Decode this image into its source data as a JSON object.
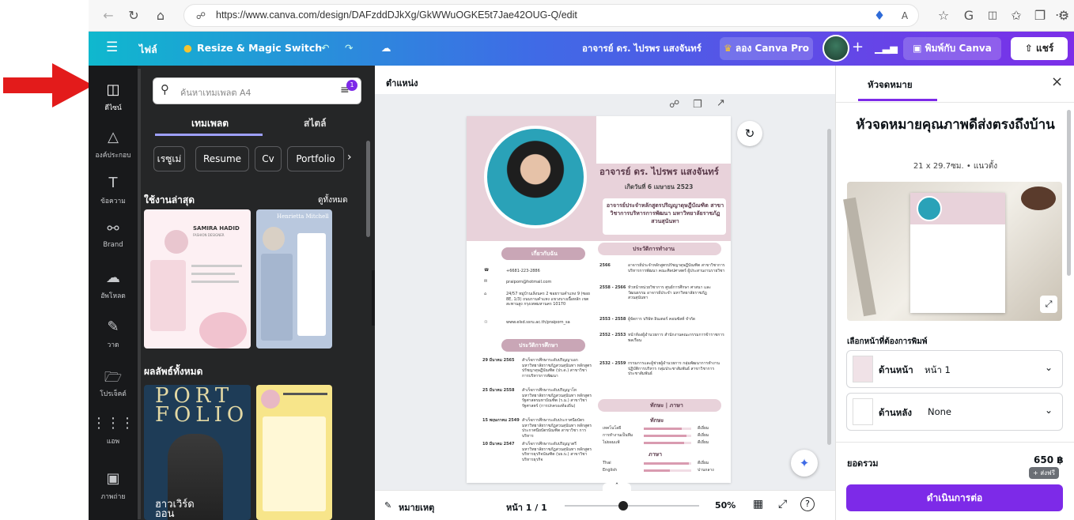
{
  "browser": {
    "url": "https://www.canva.com/design/DAFzddDJkXg/GkWWuOGKE5t7Jae42OUG-Q/edit",
    "icons": [
      "back-icon",
      "refresh-icon",
      "home-icon",
      "lock-icon",
      "favorite-icon",
      "read-aloud-icon",
      "star-icon",
      "copilot-icon",
      "split-icon",
      "favorites-icon",
      "collections-icon",
      "extensions-icon",
      "more-icon"
    ]
  },
  "topbar": {
    "file": "ไฟล์",
    "resize": "Resize & Magic Switch",
    "owner": "อาจารย์ ดร. ไปรพร แสงจันทร์",
    "try_pro": "ลอง Canva Pro",
    "print": "พิมพ์กับ Canva",
    "share": "แชร์"
  },
  "rail": {
    "items": [
      {
        "label": "ดีไซน์",
        "icon": "template-icon"
      },
      {
        "label": "องค์ประกอบ",
        "icon": "elements-icon"
      },
      {
        "label": "ข้อความ",
        "icon": "text-icon"
      },
      {
        "label": "Brand",
        "icon": "brand-icon"
      },
      {
        "label": "อัพโหลด",
        "icon": "upload-icon"
      },
      {
        "label": "วาด",
        "icon": "draw-icon"
      },
      {
        "label": "โปรเจ็คต์",
        "icon": "folder-icon"
      },
      {
        "label": "แอพ",
        "icon": "apps-icon"
      },
      {
        "label": "ภาพถ่าย",
        "icon": "photos-icon"
      }
    ]
  },
  "panel": {
    "search_placeholder": "ค้นหาเทมเพลต A4",
    "badge": "1",
    "tab_templates": "เทมเพลต",
    "tab_styles": "สไตล์",
    "chips": [
      "เรซูเม่",
      "Resume",
      "Cv",
      "Portfolio"
    ],
    "recent_title": "ใช้งานล่าสุด",
    "see_all": "ดูทั้งหมด",
    "all_results": "ผลลัพธ์ทั้งหมด",
    "thumb1_name": "SAMIRA HADID",
    "thumb1_sub": "FASHION DESIGNER",
    "thumb2_name": "Henrietta Mitchell",
    "thumb3_title": "PORT FOLIO",
    "thumb3_name": "ฮาวเวิร์ด ออน"
  },
  "canvas": {
    "position_label": "ตำแหน่ง",
    "notes": "หมายเหตุ",
    "page_indicator": "หน้า 1 / 1",
    "zoom": "50%",
    "zoom_level": 0.5,
    "resume": {
      "name": "อาจารย์ ดร. ไปรพร แสงจันทร์",
      "born": "เกิดวันที่ 6 เมษายน 2523",
      "position": "อาจารย์ประจำหลักสูตรปริญญาดุษฎีบัณฑิต สาขาวิชาการบริหารการพัฒนา มหาวิทยาลัยราชภัฏสวนสุนันทา",
      "about_title": "เกี่ยวกับฉัน",
      "phone": "+6681-223-2886",
      "email": "praiporn@hotmail.com",
      "address": "24/57 หมู่บ้านเลิ่งนคร 2 ซอยรามคำแหง 9 (ซอย 8E, 1/3) ถนนรามคำแหง แขวงบางเนื้อหลัก เขตสะพานสูง กรุงเทพมหานคร 10170",
      "web": "www.elsd.ssru.ac.th/praiporn_sa",
      "edu_title": "ประวัติการศึกษา",
      "edu": [
        {
          "date": "29 มีนาคม 2565",
          "text": "สำเร็จการศึกษาระดับปริญญาเอก มหาวิทยาลัยราชภัฏสวนสุนันทา หลักสูตร ปรัชญาดุษฎีบัณฑิต (ปร.ด.) สาขาวิชา การบริหารการพัฒนา"
        },
        {
          "date": "25 มีนาคม 2558",
          "text": "สำเร็จการศึกษาระดับปริญญาโท มหาวิทยาลัยราชภัฏสวนสุนันทา หลักสูตร รัฐศาสตรมหาบัณฑิต (ร.ม.) สาขาวิชา รัฐศาสตร์ (การปกครองท้องถิ่น)"
        },
        {
          "date": "15 พฤษภาคม 2549",
          "text": "สำเร็จการศึกษาระดับประกาศนียบัตร มหาวิทยาลัยราชภัฏสวนสุนันทา หลักสูตร ประกาศนียบัตรบัณฑิต สาขาวิชา การบริหาร"
        },
        {
          "date": "10 มีนาคม 2547",
          "text": "สำเร็จการศึกษาระดับปริญญาตรี มหาวิทยาลัยราชภัฏสวนสุนันทา หลักสูตร บริหารธุรกิจบัณฑิต (บธ.บ.) สาขาวิชา บริหารธุรกิจ"
        }
      ],
      "work_title": "ประวัติการทำงาน",
      "work": [
        {
          "year": "2566",
          "text": "อาจารย์ประจำหลักสูตรปรัชญาดุษฎีบัณฑิต สาขาวิชาการบริหารการพัฒนา คณะศิลปศาสตร์ ผู้ประสานงานรายวิชา"
        },
        {
          "year": "2558 - 2566",
          "text": "หัวหน้าหน่วยวิชาการ ศูนย์การศึกษา ศาสนา และวัฒนธรรม อาจารย์ประจำ มหาวิทยาลัยราชภัฏสวนสุนันทา"
        },
        {
          "year": "2553 - 2558",
          "text": "ผู้จัดการ บริษัท อินเตอร์ คอนซัลท์ จำกัด"
        },
        {
          "year": "2552 - 2553",
          "text": "หน้าห้องผู้อำนวยการ สำนักงานคณะกรรมการข้าราชการพลเรือน"
        },
        {
          "year": "2532 - 2559",
          "text": "กรรมการและผู้ช่วยผู้อำนวยการ กลุ่มพัฒนาการทำงาน ปฏิบัติการบริหาร กลุ่มประชาสัมพันธ์ สาขาวิชาการประชาสัมพันธ์"
        }
      ],
      "skills_title": "ทักษะ | ภาษา",
      "skills_head": "ทักษะ",
      "skills": [
        {
          "name": "เทคโนโลยี",
          "level": "ดีเยี่ยม",
          "ratio": 0.8
        },
        {
          "name": "การทำงานเป็นทีม",
          "level": "ดีเยี่ยม",
          "ratio": 0.9
        },
        {
          "name": "ไม่ยอมแพ้",
          "level": "ดีเยี่ยม",
          "ratio": 0.85
        }
      ],
      "lang_head": "ภาษา",
      "langs": [
        {
          "name": "Thai",
          "level": "ดีเยี่ยม",
          "ratio": 0.95
        },
        {
          "name": "English",
          "level": "ปานกลาง",
          "ratio": 0.55
        }
      ]
    }
  },
  "right": {
    "tab": "หัวจดหมาย",
    "title": "หัวจดหมายคุณภาพดีส่งตรงถึงบ้าน",
    "size": "21 x 29.7ซม. • แนวตั้ง",
    "choose_label": "เลือกหน้าที่ต้องการพิมพ์",
    "front_label": "ด้านหน้า",
    "front_value": "หน้า 1",
    "back_label": "ด้านหลัง",
    "back_value": "None",
    "total_label": "ยอดรวม",
    "price": "650 ฿",
    "free_ship": "+ ส่งฟรี",
    "continue": "ดำเนินการต่อ"
  },
  "colors": {
    "accent": "#7d2ae8",
    "resume_pink": "#e8d2da",
    "resume_mauve": "#c9a6b6",
    "arrow": "#e31b1b"
  }
}
